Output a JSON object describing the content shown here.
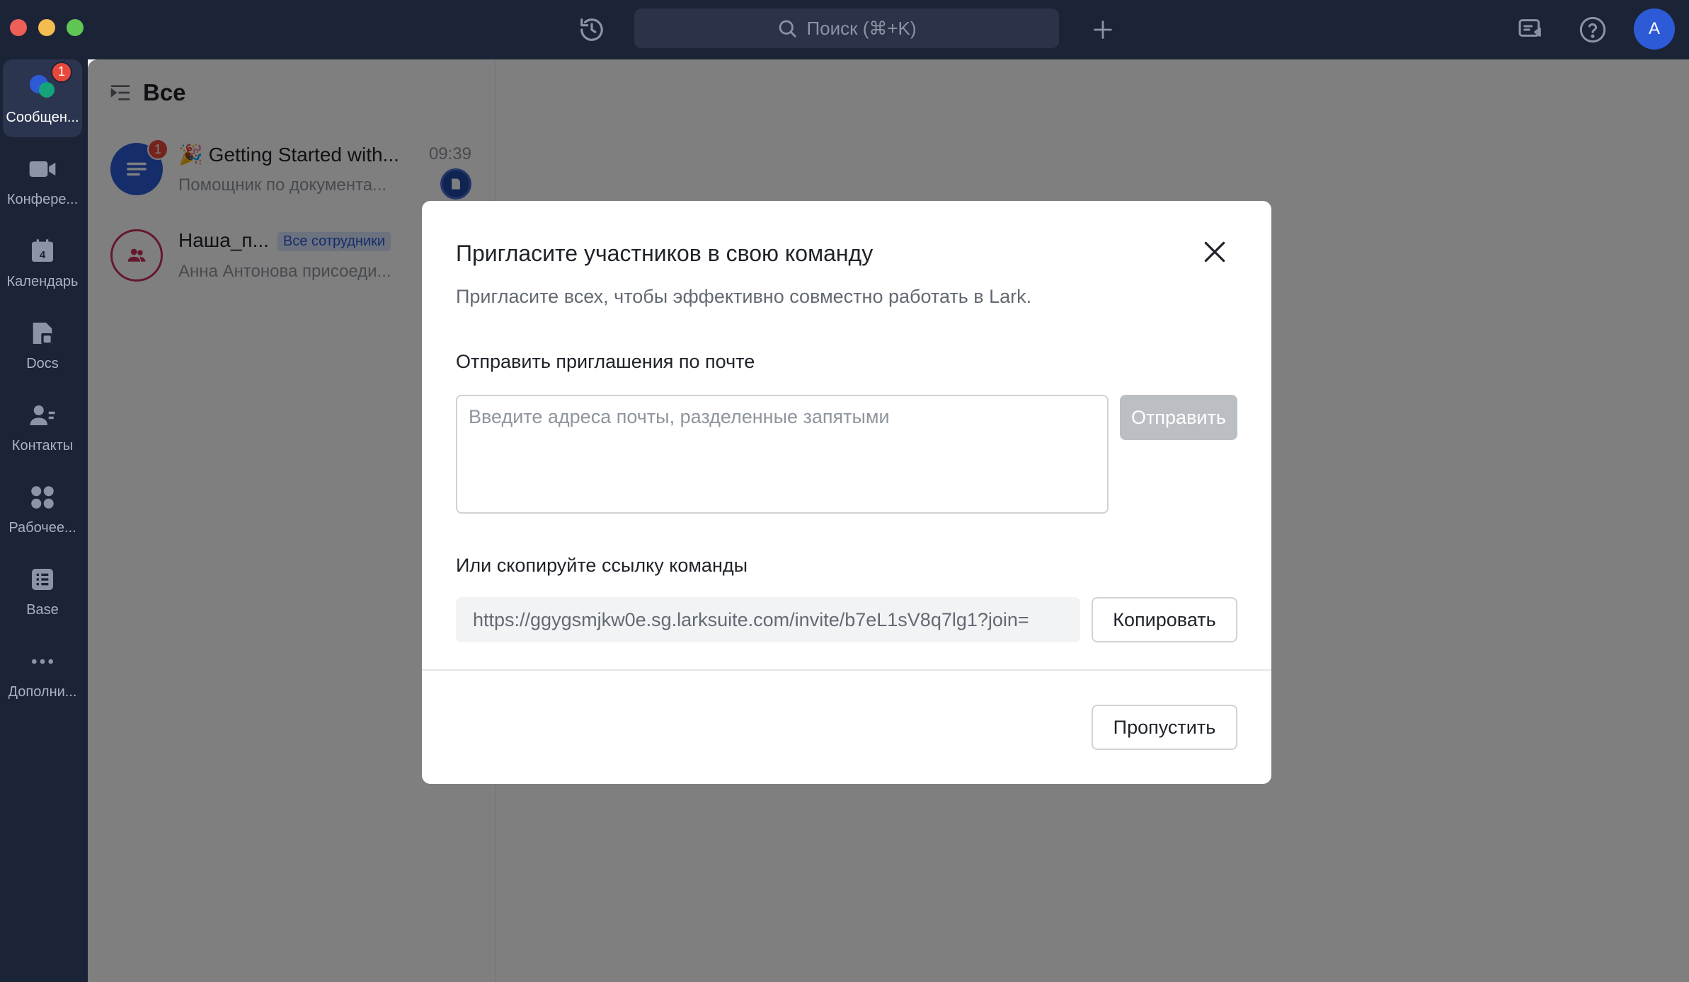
{
  "titlebar": {
    "search_placeholder": "Поиск (⌘+K)",
    "avatar_letter": "A"
  },
  "sidebar": {
    "items": [
      {
        "label": "Сообщен...",
        "icon": "messages-icon",
        "badge": "1",
        "active": true
      },
      {
        "label": "Конфере...",
        "icon": "video-camera-icon"
      },
      {
        "label": "Календарь",
        "icon": "calendar-icon",
        "icon_text": "4"
      },
      {
        "label": "Docs",
        "icon": "docs-icon"
      },
      {
        "label": "Контакты",
        "icon": "contacts-icon"
      },
      {
        "label": "Рабочее...",
        "icon": "workplace-grid-icon"
      },
      {
        "label": "Base",
        "icon": "base-icon"
      },
      {
        "label": "Дополни...",
        "icon": "more-dots-icon"
      }
    ]
  },
  "chat_list": {
    "header": "Все",
    "items": [
      {
        "title": "🎉 Getting Started with...",
        "subtitle": "Помощник по документа...",
        "time": "09:39",
        "badge": "1",
        "avatar_color": "#2d5bd7"
      },
      {
        "title": "Наша_п...",
        "tag": "Все сотрудники",
        "subtitle": "Анна Антонова присоеди...",
        "avatar_color": "#c8315a"
      }
    ]
  },
  "modal": {
    "title": "Пригласите участников в свою команду",
    "description": "Пригласите всех, чтобы эффективно совместно работать в Lark.",
    "email_section_label": "Отправить приглашения по почте",
    "email_placeholder": "Введите адреса почты, разделенные запятыми",
    "send_label": "Отправить",
    "link_section_label": "Или скопируйте ссылку команды",
    "invite_link": "https://ggygsmjkw0e.sg.larksuite.com/invite/b7eL1sV8q7lg1?join=",
    "copy_label": "Копировать",
    "skip_label": "Пропустить"
  },
  "colors": {
    "titlebar_bg": "#1b2337",
    "accent": "#2d5bd7",
    "badge": "#e8473b",
    "overlay": "rgba(0,0,0,0.5)"
  }
}
